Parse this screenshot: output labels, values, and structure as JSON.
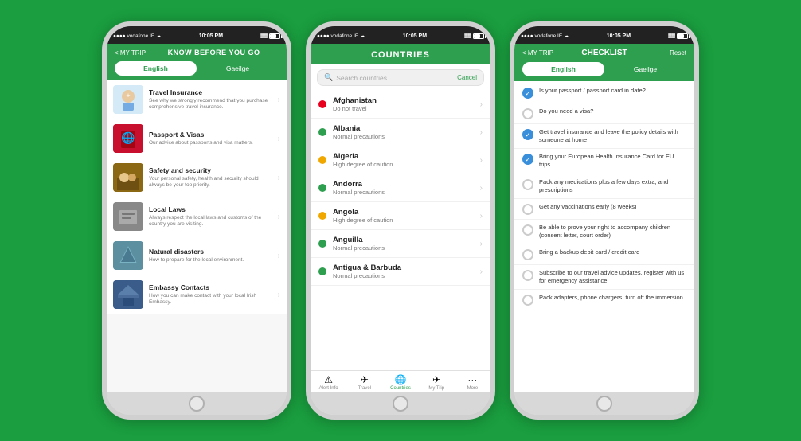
{
  "background": "#1a9e3f",
  "phone1": {
    "statusBar": {
      "left": "●●●● vodafone IE ☁",
      "center": "10:05 PM",
      "right": "⊟"
    },
    "header": {
      "back": "< MY TRIP",
      "title": "KNOW BEFORE YOU GO"
    },
    "tabs": [
      {
        "label": "English",
        "active": true
      },
      {
        "label": "Gaeilge",
        "active": false
      }
    ],
    "menuItems": [
      {
        "title": "Travel Insurance",
        "desc": "See why we strongly recommend that you purchase comprehensive travel insurance.",
        "thumbType": "insurance",
        "thumbIcon": "🏥"
      },
      {
        "title": "Passport & Visas",
        "desc": "Our advice about passports and visa matters.",
        "thumbType": "passport",
        "thumbIcon": "📕"
      },
      {
        "title": "Safety and security",
        "desc": "Your personal safety, health and security should always be your top priority.",
        "thumbType": "safety",
        "thumbIcon": "🏘"
      },
      {
        "title": "Local Laws",
        "desc": "Always respect the local laws and customs of the country you are visiting.",
        "thumbType": "laws",
        "thumbIcon": "⚖"
      },
      {
        "title": "Natural disasters",
        "desc": "How to prepare for the local environment.",
        "thumbType": "disasters",
        "thumbIcon": "🏔"
      },
      {
        "title": "Embassy Contacts",
        "desc": "How you can make contact with your local Irish Embassy.",
        "thumbType": "embassy",
        "thumbIcon": "🏛"
      }
    ]
  },
  "phone2": {
    "statusBar": {
      "left": "●●●● vodafone IE ☁",
      "center": "10:05 PM",
      "right": "⊟"
    },
    "header": {
      "title": "COUNTRIES"
    },
    "search": {
      "placeholder": "Search countries",
      "cancel": "Cancel"
    },
    "countries": [
      {
        "name": "Afghanistan",
        "status": "Do not travel",
        "dot": "red"
      },
      {
        "name": "Albania",
        "status": "Normal precautions",
        "dot": "green"
      },
      {
        "name": "Algeria",
        "status": "High degree of caution",
        "dot": "yellow"
      },
      {
        "name": "Andorra",
        "status": "Normal precautions",
        "dot": "green"
      },
      {
        "name": "Angola",
        "status": "High degree of caution",
        "dot": "yellow"
      },
      {
        "name": "Anguilla",
        "status": "Normal precautions",
        "dot": "green"
      },
      {
        "name": "Antigua & Barbuda",
        "status": "Normal precautions",
        "dot": "green"
      }
    ],
    "bottomNav": [
      {
        "icon": "⚠",
        "label": "Alert Info",
        "active": false
      },
      {
        "icon": "✈",
        "label": "Travel",
        "active": false
      },
      {
        "icon": "🌐",
        "label": "Countries",
        "active": true
      },
      {
        "icon": "🗺",
        "label": "My Trip",
        "active": false
      },
      {
        "icon": "···",
        "label": "More",
        "active": false
      }
    ]
  },
  "phone3": {
    "statusBar": {
      "left": "●●●● vodafone IE ☁",
      "center": "10:05 PM",
      "right": "⊟"
    },
    "header": {
      "back": "< MY TRIP",
      "title": "CHECKLIST",
      "reset": "Reset"
    },
    "tabs": [
      {
        "label": "English",
        "active": true
      },
      {
        "label": "Gaeilge",
        "active": false
      }
    ],
    "checklistItems": [
      {
        "text": "Is your passport / passport card in date?",
        "checked": true
      },
      {
        "text": "Do you need a visa?",
        "checked": false
      },
      {
        "text": "Get travel insurance and leave the policy details with someone at home",
        "checked": true
      },
      {
        "text": "Bring your European Health Insurance Card for EU trips",
        "checked": true
      },
      {
        "text": "Pack any medications plus a few days extra, and prescriptions",
        "checked": false
      },
      {
        "text": "Get any vaccinations early (8 weeks)",
        "checked": false
      },
      {
        "text": "Be able to prove your right to accompany children (consent letter, court order)",
        "checked": false
      },
      {
        "text": "Bring a backup debit card / credit card",
        "checked": false
      },
      {
        "text": "Subscribe to our travel advice updates, register with us for emergency assistance",
        "checked": false
      },
      {
        "text": "Pack adapters, phone chargers, turn off the immersion",
        "checked": false
      }
    ]
  }
}
